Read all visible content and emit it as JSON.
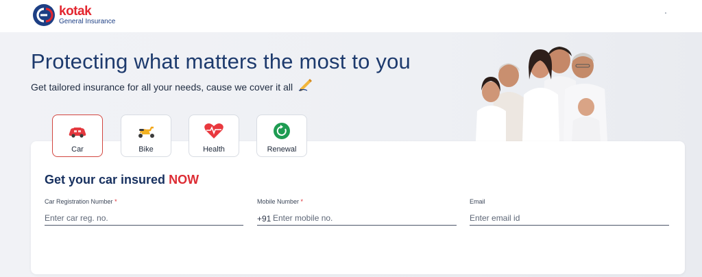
{
  "brand": {
    "name": "kotak",
    "tagline": "General Insurance",
    "colors": {
      "red": "#e3262f",
      "navy": "#1d3f84"
    }
  },
  "hero": {
    "headline": "Protecting what matters the most to you",
    "subheadline": "Get tailored insurance for all your needs, cause we cover it all",
    "emoji_icon": "writing-hand-icon",
    "image": "family-photo"
  },
  "tabs": [
    {
      "label": "Car",
      "icon": "car-icon",
      "active": true
    },
    {
      "label": "Bike",
      "icon": "scooter-icon",
      "active": false
    },
    {
      "label": "Health",
      "icon": "heart-pulse-icon",
      "active": false
    },
    {
      "label": "Renewal",
      "icon": "renewal-icon",
      "active": false
    }
  ],
  "form": {
    "title_prefix": "Get your car insured",
    "title_highlight": "NOW",
    "fields": {
      "registration": {
        "label": "Car Registration Number",
        "required_mark": "*",
        "placeholder": "Enter car reg. no.",
        "value": ""
      },
      "mobile": {
        "label": "Mobile Number",
        "required_mark": "*",
        "prefix": "+91",
        "placeholder": "Enter mobile no.",
        "value": ""
      },
      "email": {
        "label": "Email",
        "placeholder": "Enter email id",
        "value": ""
      }
    }
  },
  "colors": {
    "accent_red": "#dd2c34",
    "heading_navy": "#1d3a6d",
    "background": "#eef0f4"
  }
}
